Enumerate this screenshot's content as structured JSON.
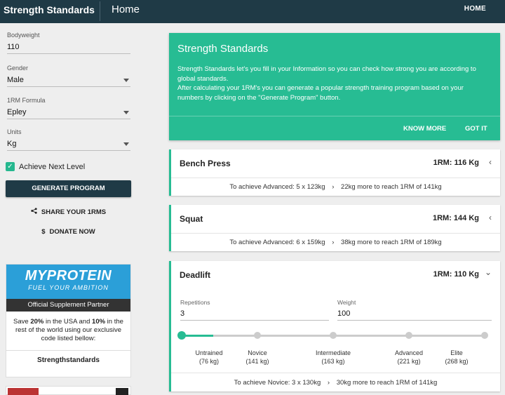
{
  "header": {
    "brand": "Strength Standards",
    "page_title": "Home",
    "home_link": "HOME"
  },
  "sidebar": {
    "bodyweight": {
      "label": "Bodyweight",
      "value": "110"
    },
    "gender": {
      "label": "Gender",
      "value": "Male"
    },
    "formula": {
      "label": "1RM Formula",
      "value": "Epley"
    },
    "units": {
      "label": "Units",
      "value": "Kg"
    },
    "achieve_next": {
      "label": "Achieve Next Level",
      "checked": true
    },
    "generate_button": "GENERATE PROGRAM",
    "share_link": "SHARE YOUR 1RMS",
    "donate_link": "DONATE NOW"
  },
  "promo": {
    "brand": "MYPROTEIN",
    "tagline": "FUEL YOUR AMBITION",
    "partner": "Official Supplement Partner",
    "desc_1": "Save ",
    "desc_usa_pct": "20%",
    "desc_2": " in the USA and ",
    "desc_world_pct": "10%",
    "desc_3": " in the rest of the world using our exclusive code listed bellow:",
    "code": "Strengthstandards"
  },
  "info": {
    "title": "Strength Standards",
    "body_1": "Strength Standards let's you fill in your Information so you can check how strong you are according to global standards.",
    "body_2": "After calculating your 1RM's you can generate a popular strength training program based on your numbers by clicking on the \"Generate Program\" button.",
    "know_more": "KNOW MORE",
    "got_it": "GOT IT"
  },
  "lifts": {
    "bench": {
      "name": "Bench Press",
      "orm": "1RM: 116 Kg",
      "hint_a": "To achieve Advanced: 5 x 123kg",
      "hint_b": "22kg more to reach 1RM of 141kg"
    },
    "squat": {
      "name": "Squat",
      "orm": "1RM: 144 Kg",
      "hint_a": "To achieve Advanced: 6 x 159kg",
      "hint_b": "38kg more to reach 1RM of 189kg"
    },
    "deadlift": {
      "name": "Deadlift",
      "orm": "1RM: 110 Kg",
      "reps_label": "Repetitions",
      "reps_value": "3",
      "weight_label": "Weight",
      "weight_value": "100",
      "progress_fraction": 0.105,
      "levels": [
        {
          "name": "Untrained",
          "weight": "(76 kg)"
        },
        {
          "name": "Novice",
          "weight": "(141 kg)"
        },
        {
          "name": "Intermediate",
          "weight": "(163 kg)"
        },
        {
          "name": "Advanced",
          "weight": "(221 kg)"
        },
        {
          "name": "Elite",
          "weight": "(268 kg)"
        }
      ],
      "hint_a": "To achieve Novice: 3 x 130kg",
      "hint_b": "30kg more to reach 1RM of 141kg"
    }
  },
  "icons": {
    "chevron_collapsed": "‹",
    "chevron_expanded": "⌄",
    "arrow": "›",
    "share": "share-icon",
    "dollar": "$"
  },
  "colors": {
    "accent": "#27bc93",
    "header": "#1f3a46",
    "promo_blue": "#2b9fd8"
  }
}
